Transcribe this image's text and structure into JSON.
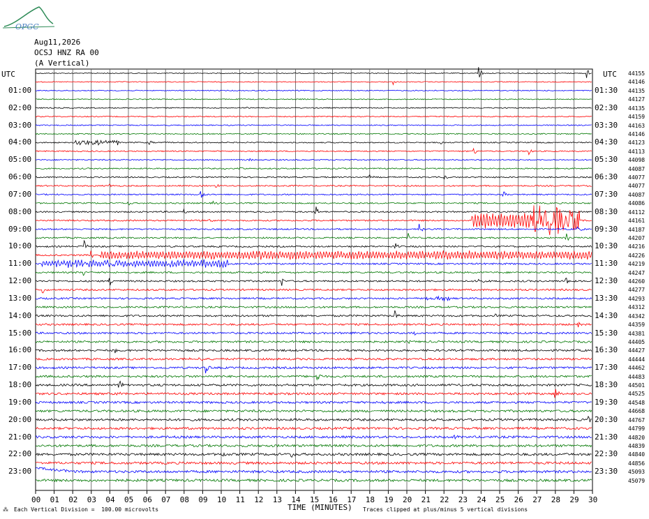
{
  "logo": {
    "text": "OPGC"
  },
  "header": {
    "date": "Aug11,2026",
    "station": "OCSJ HNZ RA 00",
    "component": "(A Vertical)"
  },
  "chart_data": {
    "type": "line",
    "title": "",
    "xlabel": "TIME (MINUTES)",
    "ylabel": "",
    "xlim": [
      0,
      30
    ],
    "x_ticks": [
      "00",
      "01",
      "02",
      "03",
      "04",
      "05",
      "06",
      "07",
      "08",
      "09",
      "10",
      "11",
      "12",
      "13",
      "14",
      "15",
      "16",
      "17",
      "18",
      "19",
      "20",
      "21",
      "22",
      "23",
      "24",
      "25",
      "26",
      "27",
      "28",
      "29",
      "30"
    ],
    "left_axis_title": "UTC",
    "right_axis_title": "UTC",
    "left_hours": [
      "01:00",
      "02:00",
      "03:00",
      "04:00",
      "05:00",
      "06:00",
      "07:00",
      "08:00",
      "09:00",
      "10:00",
      "11:00",
      "12:00",
      "13:00",
      "14:00",
      "15:00",
      "16:00",
      "17:00",
      "18:00",
      "19:00",
      "20:00",
      "21:00",
      "22:00",
      "23:00"
    ],
    "right_hours": [
      "01:30",
      "02:30",
      "03:30",
      "04:30",
      "05:30",
      "06:30",
      "07:30",
      "08:30",
      "09:30",
      "10:30",
      "11:30",
      "12:30",
      "13:30",
      "14:30",
      "15:30",
      "16:30",
      "17:30",
      "18:30",
      "19:30",
      "20:30",
      "21:30",
      "22:30",
      "23:30"
    ],
    "trace_colors": [
      "#000000",
      "#ff0000",
      "#0000ff",
      "#007700"
    ],
    "trace_counts": [
      "44155",
      "44146",
      "44135",
      "44127",
      "44135",
      "44159",
      "44163",
      "44146",
      "44123",
      "44113",
      "44098",
      "44087",
      "44077",
      "44077",
      "44087",
      "44086",
      "44112",
      "44161",
      "44187",
      "44207",
      "44216",
      "44226",
      "44219",
      "44247",
      "44260",
      "44277",
      "44293",
      "44312",
      "44342",
      "44359",
      "44381",
      "44405",
      "44427",
      "44444",
      "44462",
      "44483",
      "44501",
      "44525",
      "44548",
      "44668",
      "44767",
      "44799",
      "44820",
      "44839",
      "44840",
      "44856",
      "45093",
      "45079"
    ],
    "events": [
      {
        "trace": 0,
        "minute": 23.9,
        "amp": 10
      },
      {
        "trace": 0,
        "minute": 29.7,
        "amp": 7
      },
      {
        "trace": 1,
        "minute": 19.3,
        "amp": 3
      },
      {
        "trace": 4,
        "minute": 11.3,
        "amp": 2
      },
      {
        "trace": 8,
        "minute": 2.2,
        "amp": 3,
        "dur": 2.4
      },
      {
        "trace": 8,
        "minute": 6.1,
        "amp": 5
      },
      {
        "trace": 8,
        "minute": 21.8,
        "amp": 4
      },
      {
        "trace": 9,
        "minute": 23.6,
        "amp": 6
      },
      {
        "trace": 9,
        "minute": 26.6,
        "amp": 5
      },
      {
        "trace": 10,
        "minute": 11.5,
        "amp": 4
      },
      {
        "trace": 11,
        "minute": 11.0,
        "amp": 4
      },
      {
        "trace": 12,
        "minute": 18.0,
        "amp": 4
      },
      {
        "trace": 12,
        "minute": 22.0,
        "amp": 6
      },
      {
        "trace": 13,
        "minute": 4.0,
        "amp": 3
      },
      {
        "trace": 13,
        "minute": 9.7,
        "amp": 4
      },
      {
        "trace": 14,
        "minute": 8.9,
        "amp": 9
      },
      {
        "trace": 14,
        "minute": 25.2,
        "amp": 5
      },
      {
        "trace": 15,
        "minute": 9.6,
        "amp": 4
      },
      {
        "trace": 15,
        "minute": 5.0,
        "amp": 3
      },
      {
        "trace": 16,
        "minute": 15.1,
        "amp": 9
      },
      {
        "trace": 16,
        "minute": 8.0,
        "amp": 3
      },
      {
        "trace": 17,
        "minute": 26.8,
        "amp": 14,
        "dur": 2.5
      },
      {
        "trace": 17,
        "minute": 9.4,
        "amp": 5
      },
      {
        "trace": 18,
        "minute": 20.7,
        "amp": 7
      },
      {
        "trace": 18,
        "minute": 29.2,
        "amp": 5
      },
      {
        "trace": 19,
        "minute": 20.1,
        "amp": 6
      },
      {
        "trace": 19,
        "minute": 28.6,
        "amp": 6
      },
      {
        "trace": 20,
        "minute": 2.6,
        "amp": 10
      },
      {
        "trace": 20,
        "minute": 19.4,
        "amp": 4
      },
      {
        "trace": 21,
        "minute": 3.0,
        "amp": 6
      },
      {
        "trace": 21,
        "minute": 22.0,
        "amp": 4
      },
      {
        "trace": 22,
        "minute": 1.1,
        "amp": 3,
        "dur": 3.5
      },
      {
        "trace": 22,
        "minute": 7.0,
        "amp": 2,
        "dur": 3.5
      },
      {
        "trace": 23,
        "minute": 2.6,
        "amp": 6
      },
      {
        "trace": 24,
        "minute": 4.0,
        "amp": 6
      },
      {
        "trace": 24,
        "minute": 13.3,
        "amp": 5
      },
      {
        "trace": 24,
        "minute": 23.9,
        "amp": 4
      },
      {
        "trace": 24,
        "minute": 28.6,
        "amp": 5
      },
      {
        "trace": 25,
        "minute": 0.4,
        "amp": 4
      },
      {
        "trace": 26,
        "minute": 20.8,
        "amp": 2,
        "dur": 1.6
      },
      {
        "trace": 28,
        "minute": 19.4,
        "amp": 6
      },
      {
        "trace": 28,
        "minute": 24.7,
        "amp": 4
      },
      {
        "trace": 29,
        "minute": 29.2,
        "amp": 4
      },
      {
        "trace": 30,
        "minute": 17.0,
        "amp": 3
      },
      {
        "trace": 30,
        "minute": 20.4,
        "amp": 6
      },
      {
        "trace": 31,
        "minute": 20.0,
        "amp": 4
      },
      {
        "trace": 32,
        "minute": 4.3,
        "amp": 5
      },
      {
        "trace": 33,
        "minute": 8.1,
        "amp": 2,
        "dur": 1.0
      },
      {
        "trace": 33,
        "minute": 18.6,
        "amp": 2
      },
      {
        "trace": 34,
        "minute": 9.2,
        "amp": 8
      },
      {
        "trace": 35,
        "minute": 15.2,
        "amp": 10
      },
      {
        "trace": 36,
        "minute": 4.5,
        "amp": 10
      },
      {
        "trace": 37,
        "minute": 4.4,
        "amp": 6
      },
      {
        "trace": 37,
        "minute": 28.0,
        "amp": 8
      },
      {
        "trace": 38,
        "minute": 18.6,
        "amp": 5
      },
      {
        "trace": 40,
        "minute": 4.6,
        "amp": 4
      },
      {
        "trace": 40,
        "minute": 29.8,
        "amp": 4
      },
      {
        "trace": 42,
        "minute": 3.5,
        "amp": 3
      },
      {
        "trace": 42,
        "minute": 22.6,
        "amp": 3
      },
      {
        "trace": 44,
        "minute": 10.1,
        "amp": 5
      },
      {
        "trace": 44,
        "minute": 13.8,
        "amp": 5
      }
    ],
    "bursts": [
      {
        "trace": 17,
        "start": 23.5,
        "end": 28.3,
        "amp": 12
      },
      {
        "trace": 21,
        "start": 3.5,
        "end": 30.0,
        "amp": 6
      },
      {
        "trace": 22,
        "start": 0.3,
        "end": 6.0,
        "amp": 4
      },
      {
        "trace": 22,
        "start": 6.0,
        "end": 10.4,
        "amp": 5
      }
    ],
    "drift": [
      {
        "trace": 46,
        "start": 0.0,
        "end": 2.3
      }
    ],
    "grid": true
  },
  "footer": {
    "vertical_division": "Each Vertical Division =  100.00 microvolts",
    "clip_note": "Traces clipped at plus/minus 5 vertical divisions"
  }
}
